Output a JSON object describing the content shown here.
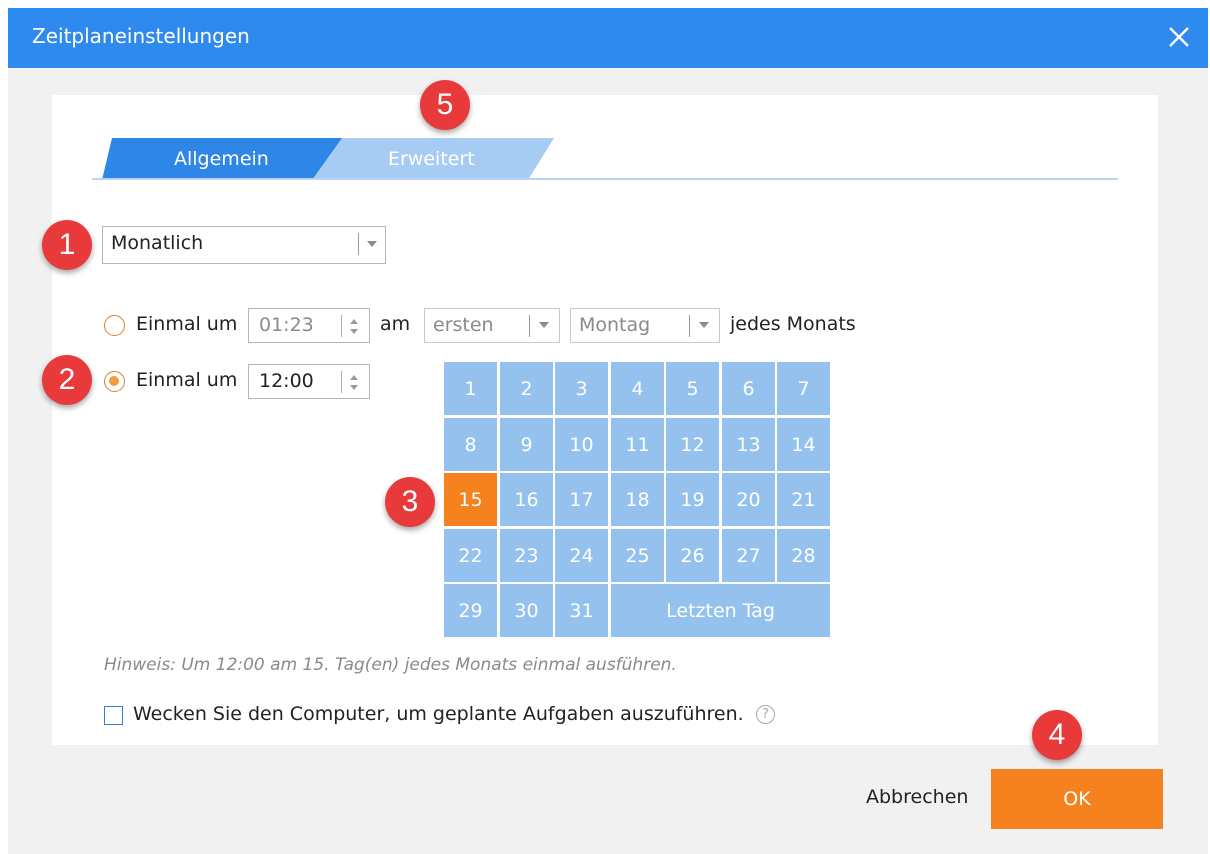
{
  "window": {
    "title": "Zeitplaneinstellungen"
  },
  "tabs": [
    {
      "label": "Allgemein",
      "active": true
    },
    {
      "label": "Erweitert",
      "active": false
    }
  ],
  "schedule_type": {
    "value": "Monatlich"
  },
  "option1": {
    "label": "Einmal um",
    "time": "01:23",
    "am_label": "am",
    "ordinal": "ersten",
    "weekday": "Montag",
    "suffix": "jedes Monats",
    "selected": false
  },
  "option2": {
    "label": "Einmal um",
    "time": "12:00",
    "selected": true
  },
  "calendar": {
    "days": [
      "1",
      "2",
      "3",
      "4",
      "5",
      "6",
      "7",
      "8",
      "9",
      "10",
      "11",
      "12",
      "13",
      "14",
      "15",
      "16",
      "17",
      "18",
      "19",
      "20",
      "21",
      "22",
      "23",
      "24",
      "25",
      "26",
      "27",
      "28",
      "29",
      "30",
      "31"
    ],
    "last_day_label": "Letzten Tag",
    "selected_day": "15"
  },
  "hint": "Hinweis: Um 12:00 am 15. Tag(en) jedes Monats einmal ausführen.",
  "wake": {
    "label": "Wecken Sie den Computer, um geplante Aufgaben auszuführen.",
    "checked": false,
    "help_glyph": "?"
  },
  "buttons": {
    "cancel": "Abbrechen",
    "ok": "OK"
  },
  "markers": [
    "1",
    "2",
    "3",
    "4",
    "5"
  ],
  "colors": {
    "titlebar": "#2f8af0",
    "tab_active": "#2e86e6",
    "tab_inactive": "#a7ccf3",
    "calendar_cell": "#94c1ee",
    "selected": "#f5821f",
    "marker": "#e83a3a"
  }
}
